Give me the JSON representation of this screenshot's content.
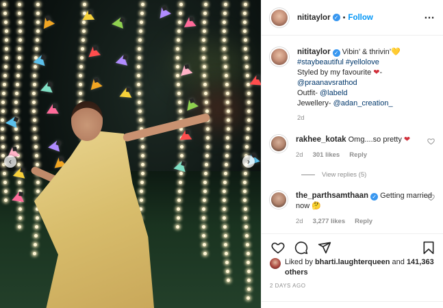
{
  "post": {
    "username": "nititaylor",
    "follow_label": "Follow",
    "more_icon": "…"
  },
  "caption": {
    "username": "nititaylor",
    "text_1": "Vibin’ & thrivin’",
    "heart": "💛",
    "hashtags": "#staybeautiful #yellolove",
    "line_styled": "Styled by my favourite",
    "heart_red": "❤",
    "dash": "-",
    "mention_stylist": "@praanavsrathod",
    "outfit_label": "Outfit-",
    "mention_outfit": "@labeld",
    "jewellery_label": "Jewellery-",
    "mention_jewellery": "@adan_creation_",
    "time": "2d"
  },
  "comments": [
    {
      "username": "rakhee_kotak",
      "text": "Omg....so pretty",
      "emoji": "❤",
      "time": "2d",
      "likes": "301 likes",
      "reply": "Reply",
      "view_replies": "View replies (5)"
    },
    {
      "username": "the_parthsamthaan",
      "text": "Getting married now",
      "emoji": "🤔",
      "time": "2d",
      "likes": "3,277 likes",
      "reply": "Reply"
    }
  ],
  "likes": {
    "prefix": "Liked by",
    "user": "bharti.laughterqueen",
    "and": "and",
    "count": "141,363 others"
  },
  "date": "2 DAYS AGO",
  "icons": {
    "like": "heart-icon",
    "comment": "comment-icon",
    "share": "paper-plane-icon",
    "save": "bookmark-icon",
    "prev": "chevron-left-icon",
    "next": "chevron-right-icon"
  },
  "colors": {
    "accent": "#0095f6",
    "verified": "#3897f0",
    "mention": "#00376b",
    "muted": "#8e8e8e"
  }
}
